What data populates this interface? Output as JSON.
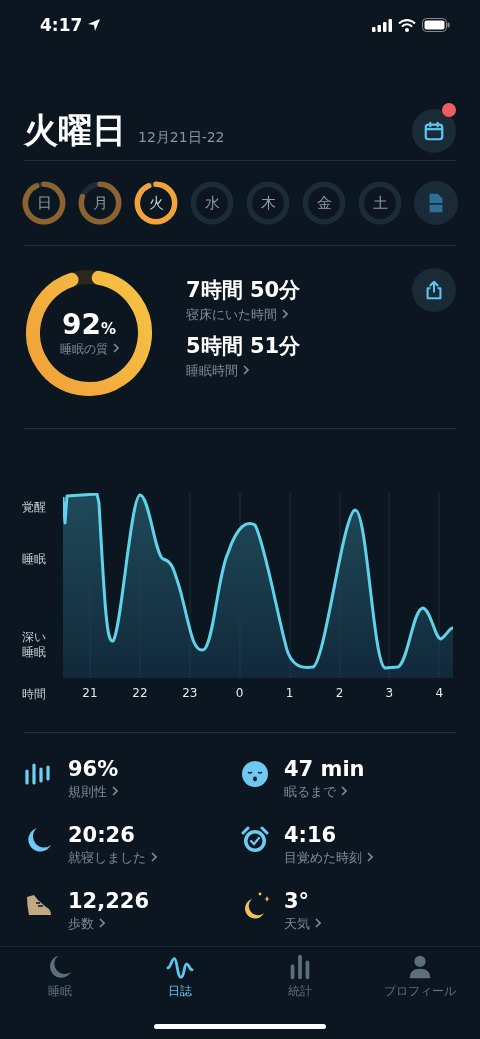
{
  "status_bar": {
    "time": "4:17"
  },
  "header": {
    "title": "火曜日",
    "date_range": "12月21日-22",
    "calendar_badge": true
  },
  "days": [
    {
      "label": "日",
      "recorded": true,
      "complete": true,
      "selected": false
    },
    {
      "label": "月",
      "recorded": true,
      "complete": false,
      "selected": false
    },
    {
      "label": "火",
      "recorded": true,
      "complete": true,
      "selected": true
    },
    {
      "label": "水",
      "recorded": false,
      "complete": false,
      "selected": false
    },
    {
      "label": "木",
      "recorded": false,
      "complete": false,
      "selected": false
    },
    {
      "label": "金",
      "recorded": false,
      "complete": false,
      "selected": false
    },
    {
      "label": "土",
      "recorded": false,
      "complete": false,
      "selected": false
    }
  ],
  "quality": {
    "value": "92",
    "unit": "%",
    "label": "睡眠の質"
  },
  "durations": [
    {
      "value": "7時間 50分",
      "label": "寝床にいた時間"
    },
    {
      "value": "5時間 51分",
      "label": "睡眠時間"
    }
  ],
  "sleep_graph": {
    "y_labels": [
      "覚醒",
      "睡眠",
      "深い睡眠"
    ],
    "x_title": "時間",
    "x_labels": [
      "21",
      "22",
      "23",
      "0",
      "1",
      "2",
      "3",
      "4"
    ]
  },
  "metrics": [
    {
      "kind": "regularity",
      "value": "96%",
      "label": "規則性"
    },
    {
      "kind": "latency",
      "value": "47 min",
      "label": "眠るまで"
    },
    {
      "kind": "bedtime",
      "value": "20:26",
      "label": "就寝しました"
    },
    {
      "kind": "wake",
      "value": "4:16",
      "label": "目覚めた時刻"
    },
    {
      "kind": "steps",
      "value": "12,226",
      "label": "歩数"
    },
    {
      "kind": "weather",
      "value": "3°",
      "label": "天気"
    }
  ],
  "tabs": [
    {
      "kind": "sleep",
      "label": "睡眠",
      "selected": false
    },
    {
      "kind": "journal",
      "label": "日誌",
      "selected": true
    },
    {
      "kind": "stats",
      "label": "統計",
      "selected": false
    },
    {
      "kind": "profile",
      "label": "プロフィール",
      "selected": false
    }
  ]
}
